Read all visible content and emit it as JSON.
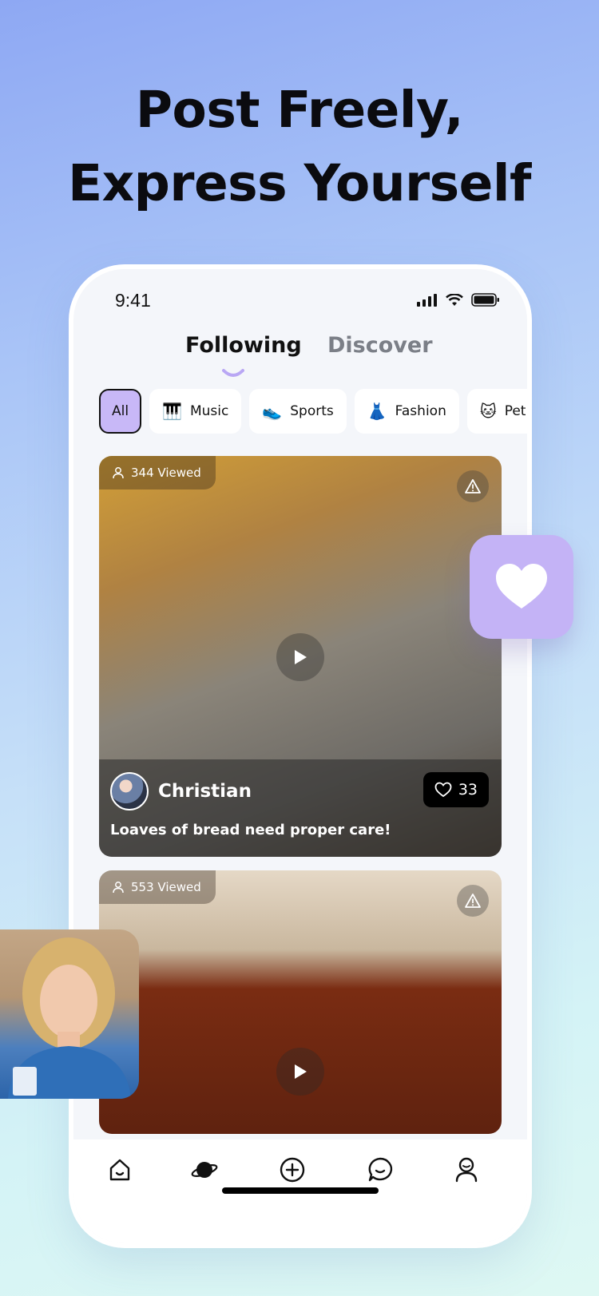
{
  "headline": {
    "line1": "Post Freely,",
    "line2": "Express Yourself"
  },
  "status_bar": {
    "time": "9:41"
  },
  "tabs": [
    {
      "label": "Following",
      "active": true
    },
    {
      "label": "Discover",
      "active": false
    }
  ],
  "categories": [
    {
      "label": "All",
      "emoji": ""
    },
    {
      "label": "Music",
      "emoji": "🎹"
    },
    {
      "label": "Sports",
      "emoji": "👟"
    },
    {
      "label": "Fashion",
      "emoji": "👗"
    },
    {
      "label": "Pet",
      "emoji": "🐱"
    }
  ],
  "posts": [
    {
      "viewed": "344 Viewed",
      "author": "Christian",
      "likes": "33",
      "caption": "Loaves of bread need proper care!"
    },
    {
      "viewed": "553 Viewed"
    }
  ],
  "nav": [
    {
      "icon": "home-icon"
    },
    {
      "icon": "planet-icon"
    },
    {
      "icon": "add-icon"
    },
    {
      "icon": "chat-icon"
    },
    {
      "icon": "profile-icon"
    }
  ],
  "colors": {
    "accent": "#c8b8f7",
    "badge": "#c4b3f6"
  }
}
